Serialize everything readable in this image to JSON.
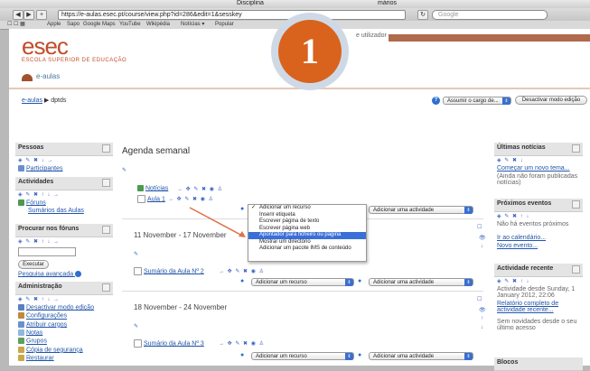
{
  "browser": {
    "window_title_left": "Disciplina",
    "window_title_right": "mários",
    "url": "https://e-aulas.esec.pt/course/view.php?id=286&edit=1&sesskey",
    "search_placeholder": "Google",
    "bookmarks": [
      "Apple",
      "Sapo",
      "Google Maps",
      "YouTube",
      "Wikipédia",
      "Notícias ▾",
      "Popular"
    ]
  },
  "header": {
    "logo": "esec",
    "logo_sub": "ESCOLA SUPERIOR DE EDUCAÇÃO",
    "portal": "e-aulas",
    "user_prefix": "e utilizador"
  },
  "breadcrumb": {
    "home": "e-aulas",
    "separator": "▶",
    "course": "dptds"
  },
  "top_controls": {
    "role_select": "Assumir o cargo de...",
    "edit_button": "Desactivar modo edição"
  },
  "left": {
    "people": {
      "title": "Pessoas",
      "items": [
        "Participantes"
      ]
    },
    "activities": {
      "title": "Actividades",
      "items": [
        "Fóruns",
        "Sumários das Aulas"
      ]
    },
    "forum_search": {
      "title": "Procurar nos fóruns",
      "button": "Executar",
      "advanced": "Pesquisa avançada"
    },
    "admin": {
      "title": "Administração",
      "items": [
        "Desactivar modo edição",
        "Configurações",
        "Atribuir cargos",
        "Notas",
        "Grupos",
        "Cópia de segurança",
        "Restaurar"
      ]
    }
  },
  "main": {
    "title": "Agenda semanal",
    "section0_links": [
      "Notícias",
      "Aula 1"
    ],
    "add_resource": "Adicionar um recurso",
    "add_activity": "Adicionar uma actividade",
    "weeks": [
      {
        "label": "11 November - 17 November",
        "summary": "Sumário da Aula Nº 2"
      },
      {
        "label": "18 November - 24 November",
        "summary": "Sumário da Aula Nº 3"
      }
    ]
  },
  "resource_menu": {
    "items": [
      "Adicionar um recurso",
      "Inserir etiqueta",
      "Escrever página de texto",
      "Escrever página web",
      "Apontador para ficheiro ou página",
      "Mostrar um directório",
      "Adicionar um pacote IMS de conteúdo"
    ],
    "checked_index": 0,
    "highlighted_index": 4
  },
  "right": {
    "news": {
      "title": "Últimas notícias",
      "link": "Começar um novo tema...",
      "note": "(Ainda não foram publicadas notícias)"
    },
    "events": {
      "title": "Próximos eventos",
      "note": "Não há eventos próximos",
      "links": [
        "Ir ao calendário...",
        "Novo evento..."
      ]
    },
    "recent": {
      "title": "Actividade recente",
      "since": "Actividade desde Sunday, 1 January 2012, 22:06",
      "report": "Relatório completo de actividade recente...",
      "none": "Sem novidades desde o seu último acesso"
    },
    "last_block": "Blocos"
  },
  "step_badge": "1",
  "colors": {
    "brand": "#c24d2a",
    "badge": "#d9631d",
    "link": "#2255aa",
    "highlight": "#3b6fd8"
  }
}
